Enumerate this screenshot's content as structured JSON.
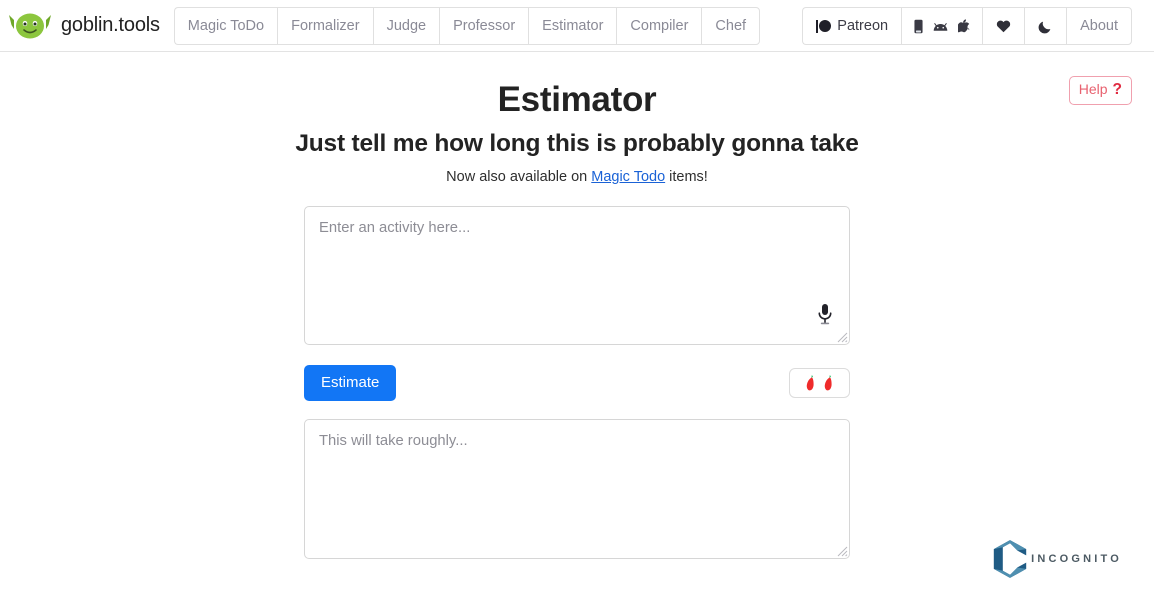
{
  "navbar": {
    "brand": {
      "name": "goblin.tools",
      "logo_icon": "goblin-head-icon"
    },
    "tabs": [
      {
        "label": "Magic ToDo"
      },
      {
        "label": "Formalizer"
      },
      {
        "label": "Judge"
      },
      {
        "label": "Professor"
      },
      {
        "label": "Estimator"
      },
      {
        "label": "Compiler"
      },
      {
        "label": "Chef"
      }
    ],
    "right": {
      "patreon": {
        "label": "Patreon",
        "icon": "patreon-logo-icon"
      },
      "platforms": {
        "icons": [
          "mobile-phone-icon",
          "android-icon",
          "apple-icon"
        ]
      },
      "donate": {
        "icon": "heart-icon"
      },
      "theme": {
        "icon": "moon-icon"
      },
      "about": {
        "label": "About"
      }
    }
  },
  "main": {
    "help_button": {
      "label": "Help",
      "mark": "?"
    },
    "title": "Estimator",
    "subtitle": "Just tell me how long this is probably gonna take",
    "note": {
      "prefix": "Now also available on ",
      "link": "Magic Todo",
      "suffix": " items!"
    },
    "input": {
      "placeholder": "Enter an activity here...",
      "value": "",
      "mic_icon": "microphone-icon",
      "resize_icon": "resize-grip-icon"
    },
    "estimate_button": {
      "label": "Estimate",
      "color": "#1276f5"
    },
    "spiciness": {
      "level": 2,
      "max": 5,
      "icon": "chili-pepper-icon",
      "color": "#ef2b2b"
    },
    "output": {
      "placeholder": "This will take roughly...",
      "value": "",
      "resize_icon": "resize-grip-icon"
    }
  },
  "watermark": {
    "text": "INCOGNITO",
    "icon": "incognito-hex-logo-icon",
    "colors": {
      "dark": "#1f5b84",
      "light": "#4f8fb0"
    }
  }
}
